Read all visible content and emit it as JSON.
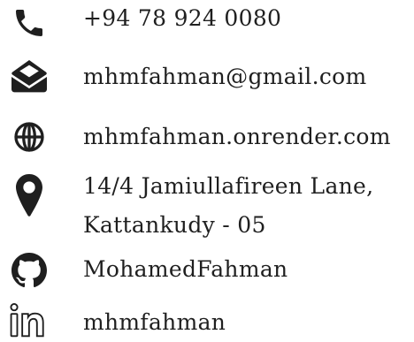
{
  "contacts": {
    "phone": {
      "value": "+94 78 924 0080",
      "icon": "phone-icon"
    },
    "email": {
      "value": "mhmfahman@gmail.com",
      "icon": "envelope-open-icon"
    },
    "website": {
      "value": "mhmfahman.onrender.com",
      "icon": "globe-icon"
    },
    "address": {
      "line1": "14/4 Jamiullafireen Lane,",
      "line2": "Kattankudy - 05",
      "icon": "map-pin-icon"
    },
    "github": {
      "value": "MohamedFahman",
      "icon": "github-icon"
    },
    "linkedin": {
      "value": "mhmfahman",
      "icon": "linkedin-icon"
    }
  },
  "colors": {
    "text": "#1f1f1f",
    "icon": "#1f1f1f",
    "background": "#ffffff"
  }
}
